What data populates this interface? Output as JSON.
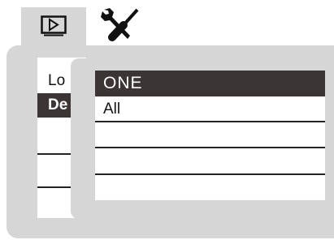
{
  "tabs": {
    "playback_icon": "play-icon",
    "setup_icon": "wrench-screwdriver-icon"
  },
  "base_menu": {
    "items": [
      {
        "label": "Lo"
      },
      {
        "label": "De"
      }
    ]
  },
  "popup": {
    "options": [
      {
        "label": "ONE",
        "selected": true
      },
      {
        "label": "All",
        "selected": false
      }
    ]
  },
  "colors": {
    "panel": "#d6d6d6",
    "highlight": "#3b3535",
    "list_bg": "#ffffff"
  }
}
